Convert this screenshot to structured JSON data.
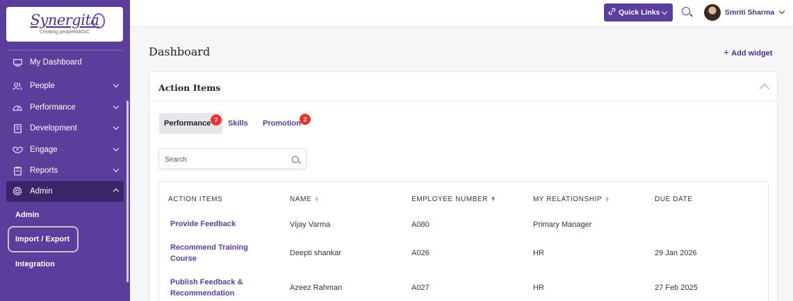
{
  "brand": {
    "name": "Synergita",
    "tagline": "Creating peopleMAGIC"
  },
  "sidebar": {
    "items": [
      {
        "label": "My Dashboard",
        "icon": "monitor-icon"
      },
      {
        "label": "People",
        "icon": "people-icon"
      },
      {
        "label": "Performance",
        "icon": "gauge-icon"
      },
      {
        "label": "Development",
        "icon": "book-icon"
      },
      {
        "label": "Engage",
        "icon": "handshake-icon"
      },
      {
        "label": "Reports",
        "icon": "clipboard-icon"
      },
      {
        "label": "Admin",
        "icon": "gear-icon",
        "expanded": true
      }
    ],
    "sub_items": [
      "Admin",
      "Import / Export",
      "Integration"
    ],
    "highlighted_sub_item": "Import / Export"
  },
  "topbar": {
    "quick_links_label": "Quick Links",
    "user_name": "Smriti Sharma"
  },
  "main": {
    "title": "Dashboard",
    "add_widget_label": "Add widget",
    "card": {
      "title": "Action Items",
      "tabs": [
        {
          "label": "Performance",
          "badge": "7",
          "active": true
        },
        {
          "label": "Skills",
          "badge": null
        },
        {
          "label": "Promotion",
          "badge": "2"
        }
      ],
      "search_placeholder": "Search",
      "table": {
        "columns": [
          "ACTION ITEMS",
          "NAME",
          "EMPLOYEE NUMBER",
          "MY RELATIONSHIP",
          "DUE DATE"
        ],
        "sort_active_column": "EMPLOYEE NUMBER",
        "rows": [
          {
            "action_line1": "Provide Feedback",
            "action_line2": "",
            "name": "Vijay Varma",
            "emp_no": "A080",
            "relationship": "Primary Manager",
            "due": ""
          },
          {
            "action_line1": "Recommend Training",
            "action_line2": "Course",
            "name": "Deepti shankar",
            "emp_no": "A026",
            "relationship": "HR",
            "due": "29 Jan 2026"
          },
          {
            "action_line1": "Publish Feedback &",
            "action_line2": "Recommendation",
            "name": "Azeez Rahman",
            "emp_no": "A027",
            "relationship": "HR",
            "due": "27 Feb 2025"
          }
        ]
      }
    }
  },
  "colors": {
    "sidebar": "#5b3d9c",
    "active_nav": "#3a256a",
    "accent": "#5b3d9c",
    "badge": "#e8332f"
  }
}
